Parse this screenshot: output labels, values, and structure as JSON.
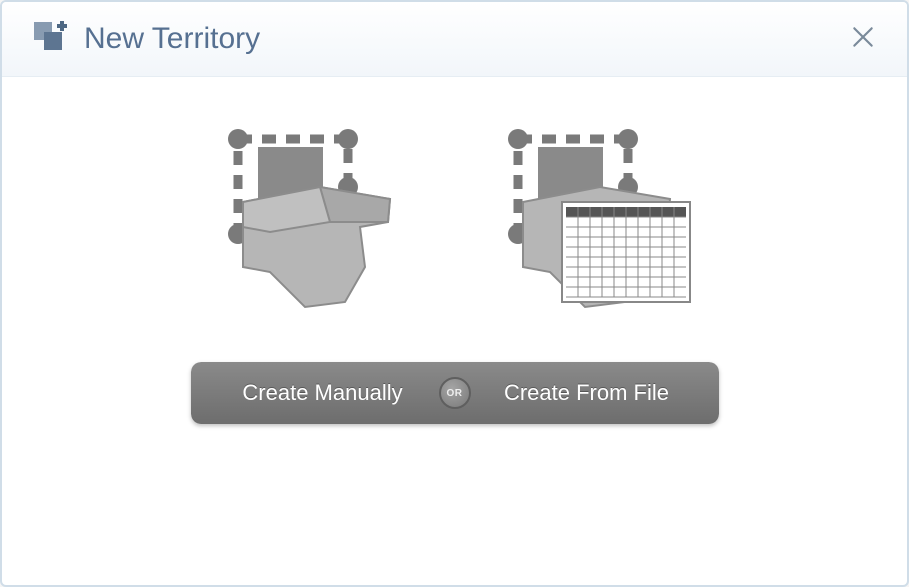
{
  "header": {
    "title": "New Territory"
  },
  "buttons": {
    "left": "Create Manually",
    "right": "Create From File",
    "or": "OR"
  }
}
